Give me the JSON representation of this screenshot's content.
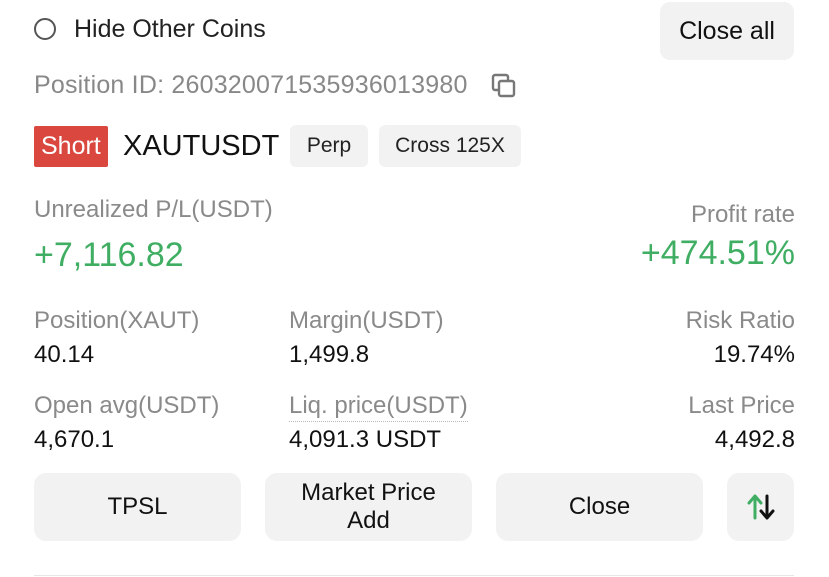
{
  "filter": {
    "hide_other_coins_label": "Hide Other Coins",
    "hide_other_coins_checked": false
  },
  "actions": {
    "close_all_label": "Close all"
  },
  "position": {
    "id_label": "Position ID: 2603200715359360139​80",
    "side": "Short",
    "symbol": "XAUTUSDT",
    "type_tag": "Perp",
    "leverage_tag": "Cross 125X"
  },
  "pnl": {
    "unrealized_label": "Unrealized P/L(USDT)",
    "unrealized_value": "+7,116.82",
    "profit_rate_label": "Profit rate",
    "profit_rate_value": "+474.51%"
  },
  "metrics": {
    "position_label": "Position(XAUT)",
    "position_value": "40.14",
    "margin_label": "Margin(USDT)",
    "margin_value": "1,499.8",
    "risk_label": "Risk Ratio",
    "risk_value": "19.74%",
    "open_avg_label": "Open avg(USDT)",
    "open_avg_value": "4,670.1",
    "liq_label": "Liq. price(USDT)",
    "liq_value": "4,091.3 USDT",
    "last_price_label": "Last Price",
    "last_price_value": "4,492.8"
  },
  "buttons": {
    "tpsl": "TPSL",
    "market_add_line1": "Market Price",
    "market_add_line2": "Add",
    "close": "Close",
    "reverse_icon": "swap-vertical-icon"
  },
  "colors": {
    "profit_green": "#3fae63",
    "short_red": "#d9473f"
  }
}
